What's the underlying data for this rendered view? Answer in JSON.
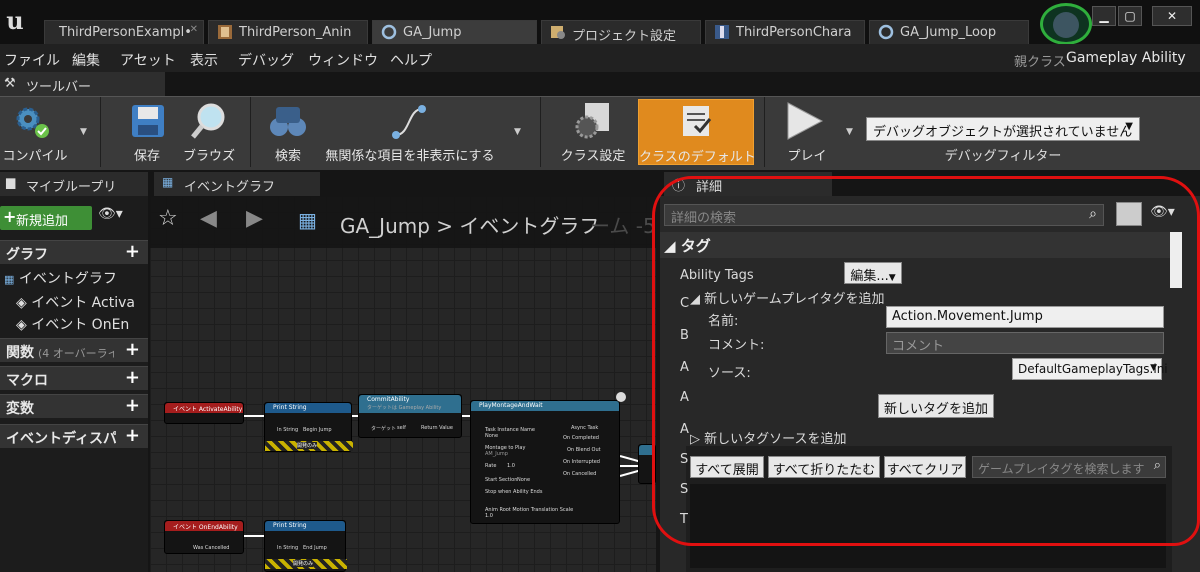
{
  "app": {
    "logo": "u",
    "parent_class_label": "親クラス",
    "parent_class_value": "Gameplay Ability"
  },
  "tabs": [
    {
      "label": "ThirdPersonExampl•",
      "icon": "level-icon"
    },
    {
      "label": "ThirdPerson_Anin",
      "icon": "anim-icon"
    },
    {
      "label": "GA_Jump",
      "icon": "blueprint-icon",
      "active": true
    },
    {
      "label": "プロジェクト設定",
      "icon": "settings-icon"
    },
    {
      "label": "ThirdPersonChara",
      "icon": "character-icon"
    },
    {
      "label": "GA_Jump_Loop",
      "icon": "blueprint-icon"
    }
  ],
  "window": {
    "minimize": "▁",
    "maximize": "▢",
    "close": "✕"
  },
  "menu": [
    "ファイル",
    "編集",
    "アセット",
    "表示",
    "デバッグ",
    "ウィンドウ",
    "ヘルプ"
  ],
  "toolbar": {
    "tab_label": "ツールバー",
    "compile": "コンパイル",
    "save": "保存",
    "browse": "ブラウズ",
    "find": "検索",
    "hide_unrelated": "無関係な項目を非表示にする",
    "class_settings": "クラス設定",
    "class_defaults": "クラスのデフォルト",
    "play": "プレイ",
    "debug_object": "デバッグオブジェクトが選択されていません",
    "debug_filter": "デバッグフィルター"
  },
  "my_blueprint": {
    "tab_label": "マイブループリ",
    "add_new": "新規追加",
    "graph_cat": "グラフ",
    "event_graph": "イベントグラフ",
    "event_activate": "イベント Activa",
    "event_onend": "イベント OnEn",
    "functions_cat": "関数",
    "functions_note": "(4 オーバーライ",
    "macros_cat": "マクロ",
    "variables_cat": "変数",
    "dispatchers_cat": "イベントディスパ"
  },
  "graph": {
    "tab_label": "イベントグラフ",
    "breadcrumb_bp": "GA_Jump",
    "breadcrumb_sep": ">",
    "breadcrumb_graph": "イベントグラフ",
    "watermark": "ーム -5",
    "nodes": {
      "activate": "イベント ActivateAbility",
      "print1": "Print String",
      "print1_in": "In String",
      "print1_val": "Begin Jump",
      "print1_dev": "開発のみ",
      "commit": "CommitAbility",
      "commit_sub": "ターゲットは Gameplay Ability",
      "commit_target": "ターゲット",
      "commit_self": "self",
      "commit_ret": "Return Value",
      "montage": "PlayMontageAndWait",
      "m_task": "Task Instance Name",
      "m_task_val": "None",
      "m_montage": "Montage to Play",
      "m_montage_val": "AM_Jump",
      "m_rate": "Rate",
      "m_rate_val": "1.0",
      "m_section": "Start Section",
      "m_section_val": "None",
      "m_stop": "Stop when Ability Ends",
      "m_anim": "Anim Root Motion Translation Scale",
      "m_anim_val": "1.0",
      "m_async": "Async Task",
      "m_completed": "On Completed",
      "m_blendout": "On Blend Out",
      "m_interrupted": "On Interrupted",
      "m_cancelled": "On Cancelled",
      "onend": "イベント OnEndAbility",
      "was_cancelled": "Was Cancelled",
      "print2": "Print String",
      "print2_in": "In String",
      "print2_val": "End Jump",
      "print2_dev": "開発のみ"
    }
  },
  "details": {
    "tab_label": "詳細",
    "search_placeholder": "詳細の検索",
    "tag_section": "タグ",
    "ability_tags": "Ability Tags",
    "edit_button": "編集...",
    "add_new_tag_section": "新しいゲームプレイタグを追加",
    "name_label": "名前:",
    "name_value": "Action.Movement.Jump",
    "comment_label": "コメント:",
    "comment_placeholder": "コメント",
    "source_label": "ソース:",
    "source_value": "DefaultGameplayTags.ini",
    "add_tag_button": "新しいタグを追加",
    "add_source_section": "新しいタグソースを追加",
    "expand_all": "すべて展開",
    "collapse_all": "すべて折りたたむ",
    "clear_all": "すべてクリア",
    "tag_search_placeholder": "ゲームプレイタグを検索します",
    "side_letters": [
      "C",
      "B",
      "A",
      "A",
      "A",
      "S",
      "S",
      "T"
    ]
  },
  "colors": {
    "accent_orange": "#e08a1e",
    "annotation_red": "#e01010",
    "badge_green": "#2fae3c"
  }
}
